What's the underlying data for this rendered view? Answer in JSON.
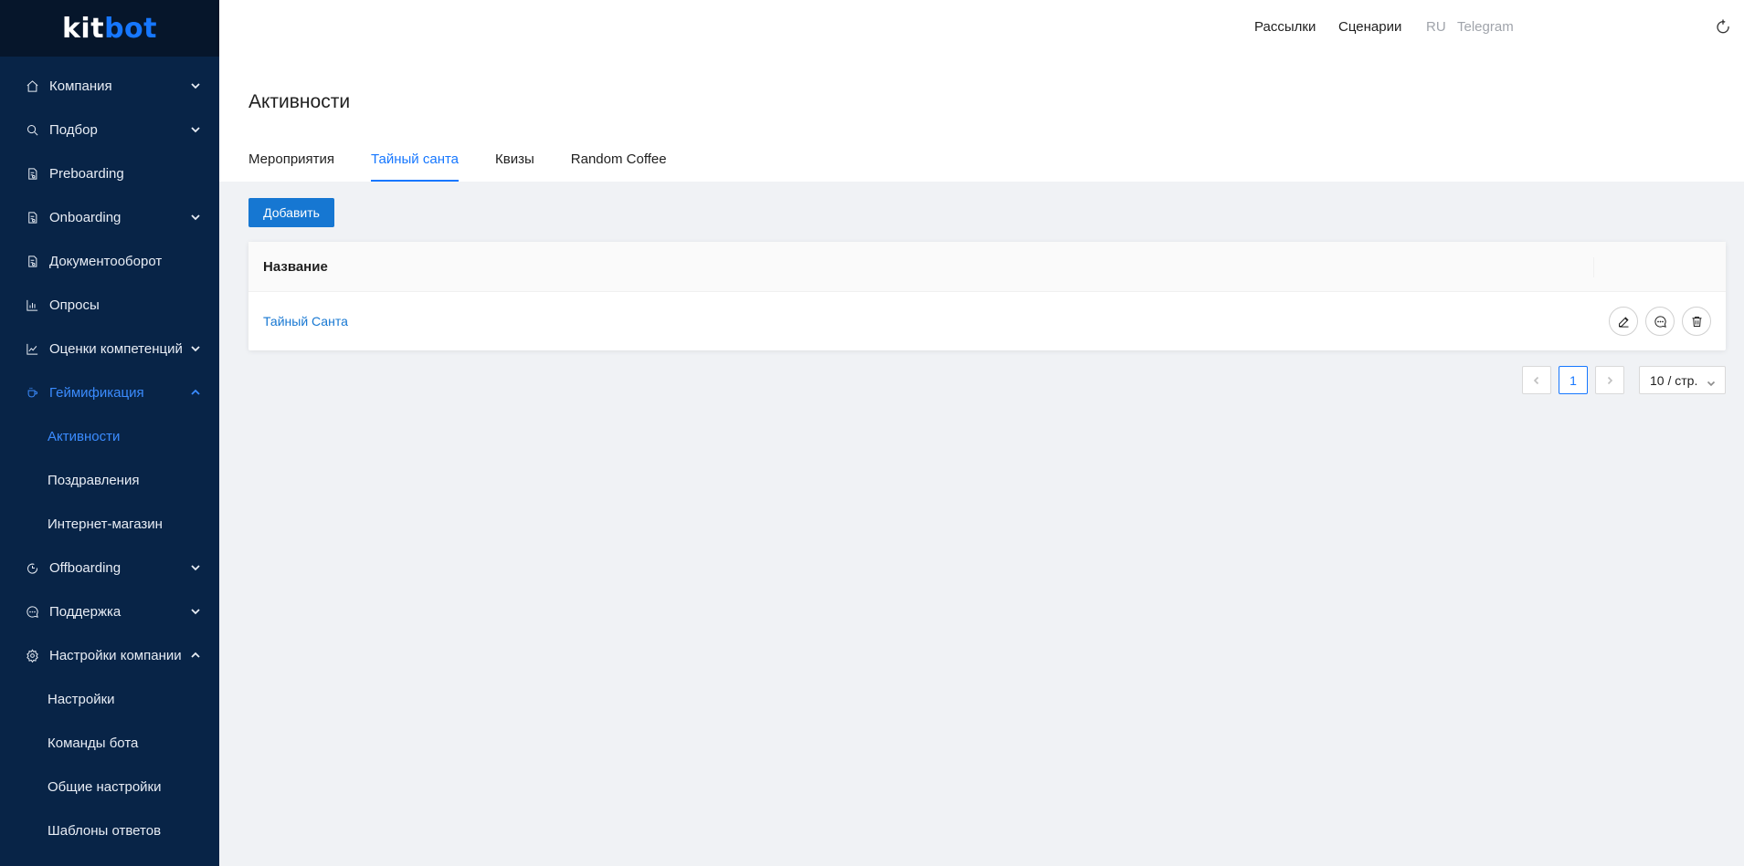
{
  "brand": {
    "logo_prefix": "kit",
    "logo_suffix": "bot"
  },
  "sidebar": {
    "items": [
      {
        "label": "Компания",
        "icon": "home-icon",
        "expandable": true,
        "expanded": false
      },
      {
        "label": "Подбор",
        "icon": "search-icon",
        "expandable": true,
        "expanded": false
      },
      {
        "label": "Preboarding",
        "icon": "document-icon",
        "expandable": false
      },
      {
        "label": "Onboarding",
        "icon": "document-icon",
        "expandable": true,
        "expanded": false
      },
      {
        "label": "Документооборот",
        "icon": "document-icon",
        "expandable": false
      },
      {
        "label": "Опросы",
        "icon": "bar-chart-icon",
        "expandable": false
      },
      {
        "label": "Оценки компетенций",
        "icon": "line-chart-icon",
        "expandable": true,
        "expanded": false
      },
      {
        "label": "Геймификация",
        "icon": "coffee-icon",
        "expandable": true,
        "expanded": true,
        "active": true
      },
      {
        "label": "Активности",
        "sub": true,
        "active": true
      },
      {
        "label": "Поздравления",
        "sub": true
      },
      {
        "label": "Интернет-магазин",
        "sub": true
      },
      {
        "label": "Offboarding",
        "icon": "logout-icon",
        "expandable": true,
        "expanded": false
      },
      {
        "label": "Поддержка",
        "icon": "message-icon",
        "expandable": true,
        "expanded": false
      },
      {
        "label": "Настройки компании",
        "icon": "gear-icon",
        "expandable": true,
        "expanded": true
      },
      {
        "label": "Настройки",
        "sub": true
      },
      {
        "label": "Команды бота",
        "sub": true
      },
      {
        "label": "Общие настройки",
        "sub": true
      },
      {
        "label": "Шаблоны ответов",
        "sub": true
      }
    ]
  },
  "header": {
    "links": [
      "Рассылки",
      "Сценарии"
    ],
    "lang": "RU",
    "channel": "Telegram"
  },
  "page": {
    "title": "Активности",
    "tabs": [
      {
        "label": "Мероприятия",
        "active": false
      },
      {
        "label": "Тайный санта",
        "active": true
      },
      {
        "label": "Квизы",
        "active": false
      },
      {
        "label": "Random Coffee",
        "active": false
      }
    ],
    "add_button": "Добавить"
  },
  "table": {
    "columns": [
      "Название"
    ],
    "rows": [
      {
        "name": "Тайный Санта"
      }
    ]
  },
  "pagination": {
    "current_page": "1",
    "page_size": "10 / стр."
  },
  "colors": {
    "sidebar_bg": "#082447",
    "accent": "#1677ff",
    "button_bg": "#1677d2"
  }
}
